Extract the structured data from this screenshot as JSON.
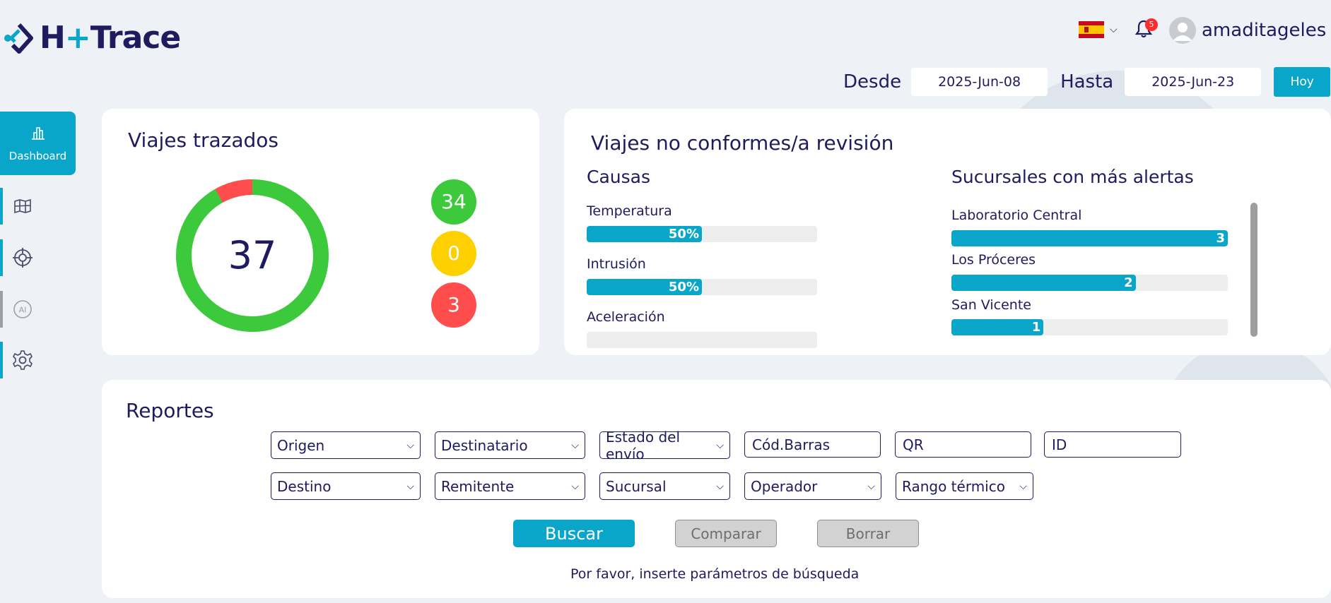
{
  "brand": {
    "logo_prefix": "H",
    "logo_plus": "+",
    "logo_suffix": "Trace"
  },
  "header": {
    "user_name": "amaditageles",
    "notification_count": "5",
    "desde_label": "Desde",
    "desde_value": "2025-Jun-08",
    "hasta_label": "Hasta",
    "hasta_value": "2025-Jun-23",
    "hoy_label": "Hoy"
  },
  "sidebar": {
    "dashboard_label": "Dashboard",
    "items": [
      "map-icon",
      "target-icon",
      "ai-icon",
      "gear-icon"
    ],
    "ai_text": "AI"
  },
  "viajes": {
    "title": "Viajes trazados",
    "total": "37",
    "counts": [
      {
        "value": "34",
        "color": "#3cc93c"
      },
      {
        "value": "0",
        "color": "#ffd000"
      },
      {
        "value": "3",
        "color": "#ff4d4d"
      }
    ],
    "donut_fraction_red": 0.081
  },
  "no_conformes": {
    "title": "Viajes no conformes/a revisión",
    "causas_title": "Causas",
    "causas": [
      {
        "label": "Temperatura",
        "percent": 50,
        "text": "50%"
      },
      {
        "label": "Intrusión",
        "percent": 50,
        "text": "50%"
      },
      {
        "label": "Aceleración",
        "percent": 0,
        "text": ""
      }
    ],
    "sucursales_title": "Sucursales con más alertas",
    "sucursales": [
      {
        "label": "Laboratorio Central",
        "value": 3,
        "text": "3"
      },
      {
        "label": "Los Próceres",
        "value": 2,
        "text": "2"
      },
      {
        "label": "San Vicente",
        "value": 1,
        "text": "1"
      }
    ],
    "sucursales_max": 3
  },
  "reportes": {
    "title": "Reportes",
    "row1_selects": [
      "Origen",
      "Destinatario",
      "Estado del envío"
    ],
    "row1_inputs": [
      "Cód.Barras",
      "QR",
      "ID"
    ],
    "row2_selects": [
      "Destino",
      "Remitente",
      "Sucursal",
      "Operador",
      "Rango térmico"
    ],
    "buscar_label": "Buscar",
    "comparar_label": "Comparar",
    "borrar_label": "Borrar",
    "hint": "Por favor, inserte parámetros de búsqueda"
  },
  "colors": {
    "accent": "#0aa6c9",
    "navy": "#1e1b5e",
    "green": "#3cc93c",
    "yellow": "#ffd000",
    "red": "#ff4d4d"
  }
}
